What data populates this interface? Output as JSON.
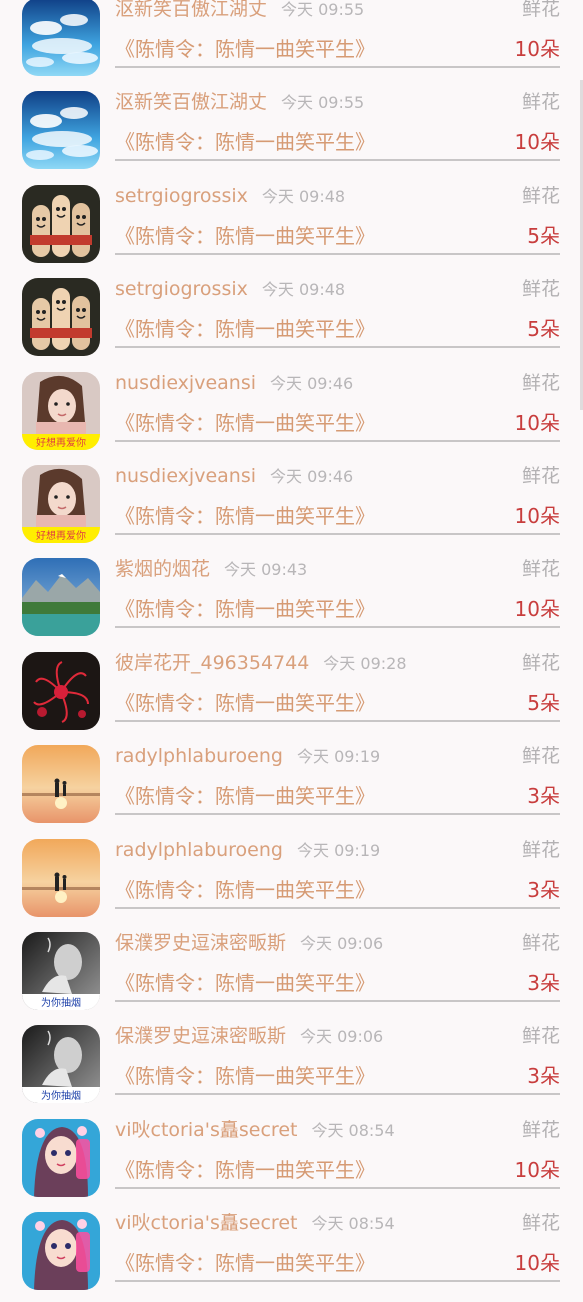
{
  "gift_unit": "鲜花",
  "song_title": "《陈情令：陈情一曲笑平生》",
  "rows": [
    {
      "name": "沤新笑百傲江湖丈",
      "time": "今天 09:55",
      "count": "10朵",
      "avatar": "sky-clouds-avatar"
    },
    {
      "name": "沤新笑百傲江湖丈",
      "time": "今天 09:55",
      "count": "10朵",
      "avatar": "sky-clouds-avatar"
    },
    {
      "name": "setrgiogrossix",
      "time": "今天 09:48",
      "count": "5朵",
      "avatar": "finger-puppets-avatar"
    },
    {
      "name": "setrgiogrossix",
      "time": "今天 09:48",
      "count": "5朵",
      "avatar": "finger-puppets-avatar"
    },
    {
      "name": "nusdiexjveansi",
      "time": "今天 09:46",
      "count": "10朵",
      "avatar": "girl-portrait-avatar",
      "caption": "好想再爱你"
    },
    {
      "name": "nusdiexjveansi",
      "time": "今天 09:46",
      "count": "10朵",
      "avatar": "girl-portrait-avatar",
      "caption": "好想再爱你"
    },
    {
      "name": "紫烟的烟花",
      "time": "今天 09:43",
      "count": "10朵",
      "avatar": "mountain-lake-avatar"
    },
    {
      "name": "彼岸花开_496354744",
      "time": "今天 09:28",
      "count": "5朵",
      "avatar": "red-spider-lily-avatar"
    },
    {
      "name": "radylphlaburoeng",
      "time": "今天 09:19",
      "count": "3朵",
      "avatar": "sunset-figure-avatar"
    },
    {
      "name": "radylphlaburoeng",
      "time": "今天 09:19",
      "count": "3朵",
      "avatar": "sunset-figure-avatar"
    },
    {
      "name": "保濮罗史逗涑密畈斯",
      "time": "今天 09:06",
      "count": "3朵",
      "avatar": "smoking-bw-avatar",
      "caption": "为你抽烟"
    },
    {
      "name": "保濮罗史逗涑密畈斯",
      "time": "今天 09:06",
      "count": "3朵",
      "avatar": "smoking-bw-avatar",
      "caption": "为你抽烟"
    },
    {
      "name": "vi吙ctoria's矗secret",
      "time": "今天 08:54",
      "count": "10朵",
      "avatar": "cartoon-girl-avatar"
    },
    {
      "name": "vi吙ctoria's矗secret",
      "time": "今天 08:54",
      "count": "10朵",
      "avatar": "cartoon-girl-avatar"
    }
  ]
}
